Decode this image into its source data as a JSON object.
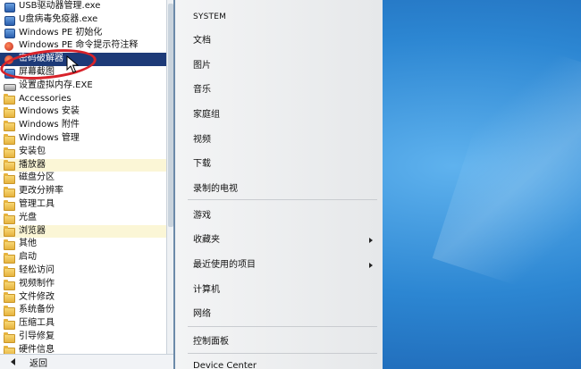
{
  "left_pane": {
    "items": [
      {
        "label": "USB驱动器管理.exe",
        "icon": "app-icon",
        "state": ""
      },
      {
        "label": "U盘病毒免疫器.exe",
        "icon": "app-icon",
        "state": ""
      },
      {
        "label": "Windows PE 初始化",
        "icon": "app-icon",
        "state": ""
      },
      {
        "label": "Windows PE 命令提示符注释",
        "icon": "red-icon",
        "state": ""
      },
      {
        "label": "密码破解器",
        "icon": "red-icon",
        "state": "selected"
      },
      {
        "label": "屏幕截图",
        "icon": "app-icon",
        "state": ""
      },
      {
        "label": "设置虚拟内存.EXE",
        "icon": "disk-icon",
        "state": ""
      },
      {
        "label": "Accessories",
        "icon": "folder-icon",
        "state": ""
      },
      {
        "label": "Windows 安装",
        "icon": "folder-icon",
        "state": ""
      },
      {
        "label": "Windows 附件",
        "icon": "folder-icon",
        "state": ""
      },
      {
        "label": "Windows 管理",
        "icon": "folder-icon",
        "state": ""
      },
      {
        "label": "安装包",
        "icon": "folder-icon",
        "state": ""
      },
      {
        "label": "播放器",
        "icon": "folder-icon",
        "state": "hl"
      },
      {
        "label": "磁盘分区",
        "icon": "folder-icon",
        "state": ""
      },
      {
        "label": "更改分辨率",
        "icon": "folder-icon",
        "state": ""
      },
      {
        "label": "管理工具",
        "icon": "folder-icon",
        "state": ""
      },
      {
        "label": "光盘",
        "icon": "folder-icon",
        "state": ""
      },
      {
        "label": "浏览器",
        "icon": "folder-icon",
        "state": "hl"
      },
      {
        "label": "其他",
        "icon": "folder-icon",
        "state": ""
      },
      {
        "label": "启动",
        "icon": "folder-icon",
        "state": ""
      },
      {
        "label": "轻松访问",
        "icon": "folder-icon",
        "state": ""
      },
      {
        "label": "视频制作",
        "icon": "folder-icon",
        "state": ""
      },
      {
        "label": "文件修改",
        "icon": "folder-icon",
        "state": ""
      },
      {
        "label": "系统备份",
        "icon": "folder-icon",
        "state": ""
      },
      {
        "label": "压缩工具",
        "icon": "folder-icon",
        "state": ""
      },
      {
        "label": "引导修复",
        "icon": "folder-icon",
        "state": ""
      },
      {
        "label": "硬件信息",
        "icon": "folder-icon",
        "state": ""
      }
    ],
    "back_label": "返回"
  },
  "right_pane": {
    "items": [
      {
        "label": "SYSTEM",
        "has_submenu": false
      },
      {
        "label": "文档",
        "has_submenu": false
      },
      {
        "label": "图片",
        "has_submenu": false
      },
      {
        "label": "音乐",
        "has_submenu": false
      },
      {
        "label": "家庭组",
        "has_submenu": false
      },
      {
        "label": "视频",
        "has_submenu": false
      },
      {
        "label": "下载",
        "has_submenu": false
      },
      {
        "label": "录制的电视",
        "has_submenu": false
      },
      {
        "label": "游戏",
        "has_submenu": false
      },
      {
        "label": "收藏夹",
        "has_submenu": true
      },
      {
        "label": "最近使用的项目",
        "has_submenu": true
      },
      {
        "label": "计算机",
        "has_submenu": false
      },
      {
        "label": "网络",
        "has_submenu": false
      },
      {
        "label": "控制面板",
        "has_submenu": false
      },
      {
        "label": "Device Center",
        "has_submenu": false
      }
    ]
  },
  "colors": {
    "selection": "#1d3a78",
    "annotation": "#d8232a",
    "desktop": "#2c86d2"
  }
}
